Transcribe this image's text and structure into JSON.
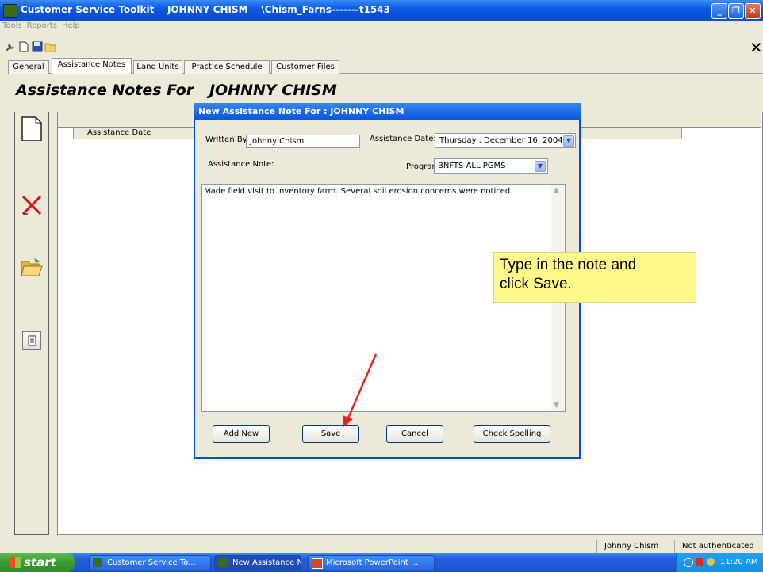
{
  "window": {
    "title": "Customer Service Toolkit    JOHNNY CHISM    \\Chism_Farns-------t1543"
  },
  "menu": [
    "Tools",
    "Reports",
    "Help"
  ],
  "toolbar_icons": [
    "wrench-icon",
    "new-document-icon",
    "save-disk-icon",
    "open-folder-icon"
  ],
  "tabs": [
    {
      "label": "General"
    },
    {
      "label": "Assistance Notes"
    },
    {
      "label": "Land Units"
    },
    {
      "label": "Practice Schedule"
    },
    {
      "label": "Customer Files"
    }
  ],
  "active_tab": "Assistance Notes",
  "page": {
    "heading": "Assistance Notes For   JOHNNY CHISM"
  },
  "grid": {
    "column_header": "Assistance Date"
  },
  "dialog": {
    "title": "New Assistance Note For : JOHNNY CHISM",
    "written_by_label": "Written By:",
    "written_by_value": "Johnny Chism",
    "assistance_date_label": "Assistance Date:",
    "assistance_date_value": "Thursday  , December 16, 2004",
    "assistance_note_label": "Assistance Note:",
    "program_label": "Program:",
    "program_value": "BNFTS ALL PGMS",
    "note_text": "Made field visit to inventory farm. Several soil erosion concerns were noticed.",
    "buttons": {
      "add_new": "Add New",
      "save": "Save",
      "cancel": "Cancel",
      "check_spelling": "Check Spelling"
    }
  },
  "callout": {
    "line1": "Type in the note and",
    "line2": "click Save."
  },
  "statusbar": {
    "user": "Johnny Chism",
    "auth": "Not authenticated"
  },
  "taskbar": {
    "start_label": "start",
    "tasks": [
      {
        "label": "Customer Service To..."
      },
      {
        "label": "New Assistance Note ..."
      },
      {
        "label": "Microsoft PowerPoint ..."
      }
    ],
    "clock": "11:20 AM"
  },
  "colors": {
    "title_bar": "#0a5be6",
    "callout_fill": "#fff98c",
    "arrow": "#e8231b",
    "delete_x": "#d4141b"
  }
}
